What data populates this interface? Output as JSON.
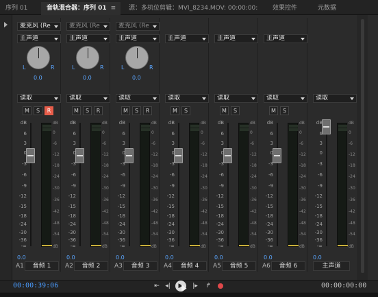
{
  "tabs": [
    {
      "label": "序列 01"
    },
    {
      "label": "音轨混合器：序列 01",
      "menu": "≡"
    },
    {
      "label": "源：多机位剪辑：MVI_8234.MOV: 00:00:00:00"
    },
    {
      "label": "效果控件"
    },
    {
      "label": "元数据"
    }
  ],
  "tracks": [
    {
      "id": "A1",
      "name": "音频 1",
      "input": "麦克风 (Re",
      "routing": "主声道",
      "pan": "0.0",
      "mode": "读取",
      "buttons": [
        "M",
        "S",
        "R"
      ],
      "record_active": true,
      "volume": "0.0"
    },
    {
      "id": "A2",
      "name": "音频 2",
      "input": "麦克风 (Re",
      "routing": "主声道",
      "pan": "0.0",
      "mode": "读取",
      "buttons": [
        "M",
        "S",
        "R"
      ],
      "record_active": false,
      "volume": "0.0"
    },
    {
      "id": "A3",
      "name": "音频 3",
      "input": "麦克风 (Re",
      "routing": "主声道",
      "pan": "0.0",
      "mode": "读取",
      "buttons": [
        "M",
        "S",
        "R"
      ],
      "record_active": false,
      "volume": "0.0"
    },
    {
      "id": "A4",
      "name": "音频 4",
      "routing": "主声道",
      "mode": "读取",
      "buttons": [
        "M",
        "S"
      ],
      "volume": "0.0"
    },
    {
      "id": "A5",
      "name": "音频 5",
      "routing": "主声道",
      "mode": "读取",
      "buttons": [
        "M",
        "S"
      ],
      "volume": "0.0"
    },
    {
      "id": "A6",
      "name": "音频 6",
      "routing": "主声道",
      "mode": "读取",
      "buttons": [
        "M",
        "S"
      ],
      "volume": "0.0"
    },
    {
      "id": "",
      "name": "主声道",
      "mode": "读取",
      "volume": "0.0"
    }
  ],
  "knob_labels": {
    "left": "L",
    "right": "R"
  },
  "fader_scale": [
    "dB",
    "6",
    "3",
    "0",
    "-3",
    "-6",
    "-9",
    "-12",
    "-15",
    "-18",
    "-24",
    "-30",
    "-36",
    "-∞"
  ],
  "meter_scale": [
    "dB",
    "0",
    "-6",
    "-12",
    "-18",
    "-24",
    "-30",
    "-36",
    "-42",
    "-48",
    "-54",
    "dB"
  ],
  "transport": {
    "current_time": "00:00:39:06",
    "duration": "00:00:00:00",
    "buttons": [
      "go-to-in-point",
      "step-back",
      "play",
      "step-forward",
      "loop",
      "record"
    ]
  },
  "colors": {
    "accent": "#4a9cff",
    "record": "#e85d4a",
    "meter_peak": "#c9b03a"
  }
}
